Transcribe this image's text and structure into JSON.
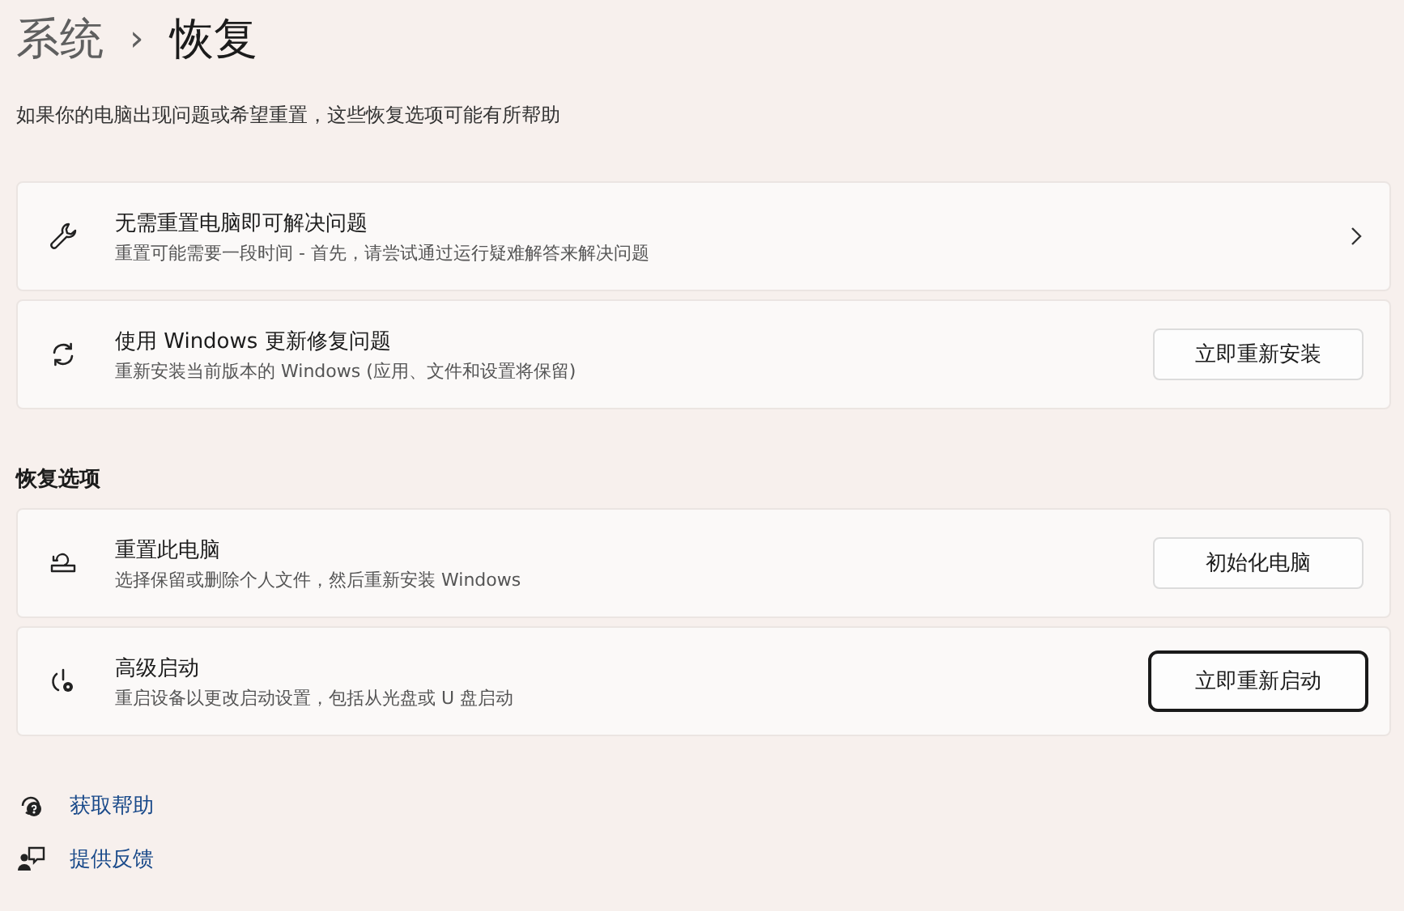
{
  "breadcrumb": {
    "parent": "系统",
    "separator": "›",
    "current": "恢复"
  },
  "description": "如果你的电脑出现问题或希望重置，这些恢复选项可能有所帮助",
  "top_items": [
    {
      "title": "无需重置电脑即可解决问题",
      "subtitle": "重置可能需要一段时间 - 首先，请尝试通过运行疑难解答来解决问题",
      "kind": "chevron"
    },
    {
      "title": "使用 Windows 更新修复问题",
      "subtitle": "重新安装当前版本的 Windows (应用、文件和设置将保留)",
      "kind": "button",
      "button": "立即重新安装",
      "focused": false
    }
  ],
  "section_title": "恢复选项",
  "recovery_items": [
    {
      "title": "重置此电脑",
      "subtitle": "选择保留或删除个人文件，然后重新安装 Windows",
      "kind": "button",
      "button": "初始化电脑",
      "focused": false
    },
    {
      "title": "高级启动",
      "subtitle": "重启设备以更改启动设置，包括从光盘或 U 盘启动",
      "kind": "button",
      "button": "立即重新启动",
      "focused": true
    }
  ],
  "links": [
    "获取帮助",
    "提供反馈"
  ]
}
